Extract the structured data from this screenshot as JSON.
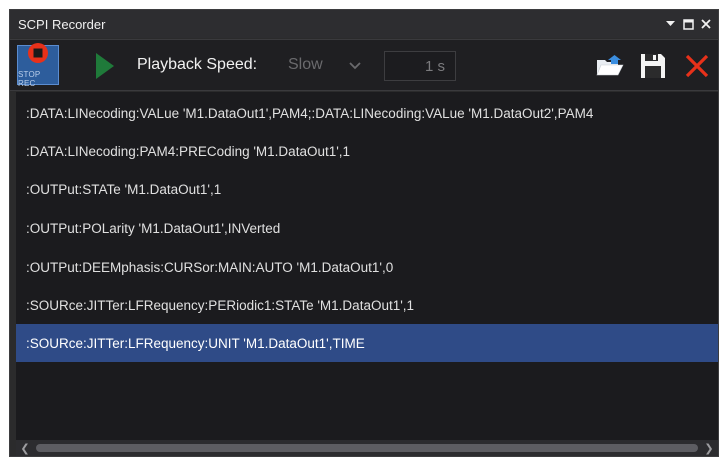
{
  "window": {
    "title": "SCPI Recorder"
  },
  "toolbar": {
    "stop_label": "STOP REC",
    "speed_label": "Playback Speed:",
    "speed_value": "Slow",
    "time_value": "1 s"
  },
  "icons": {
    "stop": "stop-record-icon",
    "play": "play-icon",
    "open": "open-folder-icon",
    "save": "save-icon",
    "clear": "delete-icon",
    "pin": "pin-dropdown-icon",
    "maximize": "maximize-icon",
    "close": "close-icon"
  },
  "colors": {
    "stop_red": "#e8311a",
    "play_green": "#1f7a3a",
    "clear_red": "#e8311a",
    "selection": "#2f4b87"
  },
  "commands": [
    ":DATA:LINecoding:VALue 'M1.DataOut1',PAM4;:DATA:LINecoding:VALue 'M1.DataOut2',PAM4",
    ":DATA:LINecoding:PAM4:PRECoding 'M1.DataOut1',1",
    ":OUTPut:STATe 'M1.DataOut1',1",
    ":OUTPut:POLarity 'M1.DataOut1',INVerted",
    ":OUTPut:DEEMphasis:CURSor:MAIN:AUTO 'M1.DataOut1',0",
    ":SOURce:JITTer:LFRequency:PERiodic1:STATe 'M1.DataOut1',1",
    ":SOURce:JITTer:LFRequency:UNIT 'M1.DataOut1',TIME"
  ],
  "selected_index": 6
}
